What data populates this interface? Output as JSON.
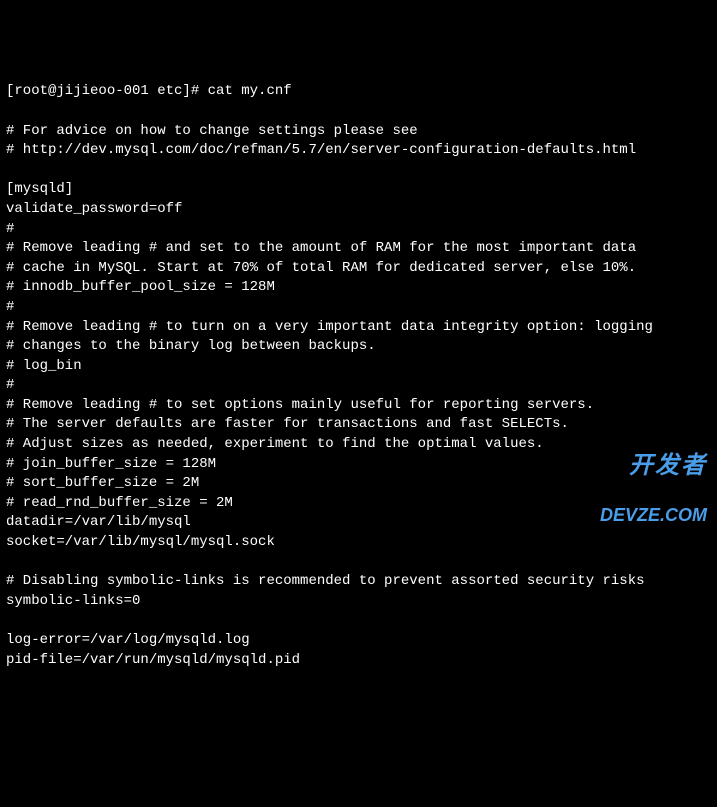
{
  "prompt": {
    "user_host": "[root@jijieoo-001 etc]# ",
    "command": "cat my.cnf"
  },
  "lines": [
    "# For advice on how to change settings please see",
    "# http://dev.mysql.com/doc/refman/5.7/en/server-configuration-defaults.html",
    "",
    "[mysqld]",
    "validate_password=off",
    "#",
    "# Remove leading # and set to the amount of RAM for the most important data",
    "# cache in MySQL. Start at 70% of total RAM for dedicated server, else 10%.",
    "# innodb_buffer_pool_size = 128M",
    "#",
    "# Remove leading # to turn on a very important data integrity option: logging",
    "# changes to the binary log between backups.",
    "# log_bin",
    "#",
    "# Remove leading # to set options mainly useful for reporting servers.",
    "# The server defaults are faster for transactions and fast SELECTs.",
    "# Adjust sizes as needed, experiment to find the optimal values.",
    "# join_buffer_size = 128M",
    "# sort_buffer_size = 2M",
    "# read_rnd_buffer_size = 2M",
    "datadir=/var/lib/mysql",
    "socket=/var/lib/mysql/mysql.sock",
    "",
    "# Disabling symbolic-links is recommended to prevent assorted security risks",
    "symbolic-links=0",
    "",
    "log-error=/var/log/mysqld.log",
    "pid-file=/var/run/mysqld/mysqld.pid"
  ],
  "watermark": {
    "cn": "开发者",
    "en": "DEVZE.COM"
  }
}
